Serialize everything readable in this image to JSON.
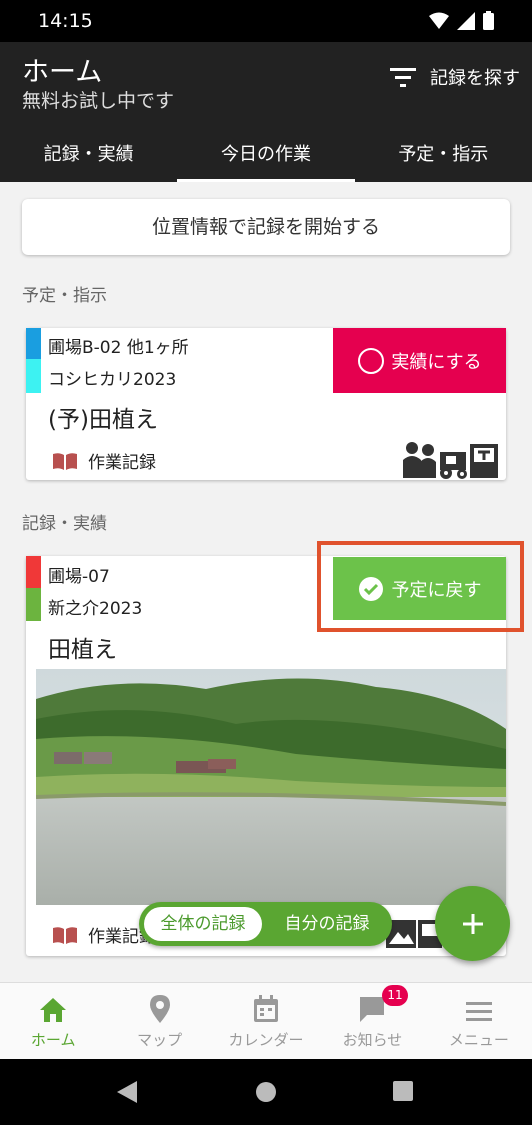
{
  "status_bar": {
    "time": "14:15"
  },
  "app_bar": {
    "title": "ホーム",
    "subtitle": "無料お試し中です",
    "search_label": "記録を探す",
    "tabs": [
      {
        "label": "記録・実績"
      },
      {
        "label": "今日の作業",
        "active": true
      },
      {
        "label": "予定・指示"
      }
    ]
  },
  "main": {
    "location_button": "位置情報で記録を開始する",
    "planned_section": {
      "label": "予定・指示",
      "card": {
        "field": "圃場B-02 他1ヶ所",
        "crop": "コシヒカリ2023",
        "title": "(予)田植え",
        "record_label": "作業記録",
        "action_label": "実績にする",
        "colors": {
          "field_stripe": "#1a9ee0",
          "crop_stripe": "#3df2f2",
          "action_bg": "#e5004f"
        }
      }
    },
    "record_section": {
      "label": "記録・実績",
      "card": {
        "field": "圃場-07",
        "crop": "新之介2023",
        "title": "田植え",
        "record_label": "作業記録",
        "action_label": "予定に戻す",
        "colors": {
          "field_stripe": "#f03838",
          "crop_stripe": "#6cb43f",
          "action_bg": "#6cc24a"
        }
      }
    }
  },
  "filter_toggle": {
    "all_label": "全体の記録",
    "mine_label": "自分の記録",
    "selected": "all"
  },
  "fab": {
    "icon": "plus-icon"
  },
  "bottom_nav": {
    "items": [
      {
        "label": "ホーム",
        "icon": "home-icon",
        "active": true
      },
      {
        "label": "マップ",
        "icon": "map-pin-icon"
      },
      {
        "label": "カレンダー",
        "icon": "calendar-icon"
      },
      {
        "label": "お知らせ",
        "icon": "chat-icon",
        "badge": "11"
      },
      {
        "label": "メニュー",
        "icon": "menu-icon"
      }
    ]
  },
  "theme": {
    "accent": "#5aa632",
    "header_bg": "#222222",
    "highlight_border": "#e0522d"
  }
}
